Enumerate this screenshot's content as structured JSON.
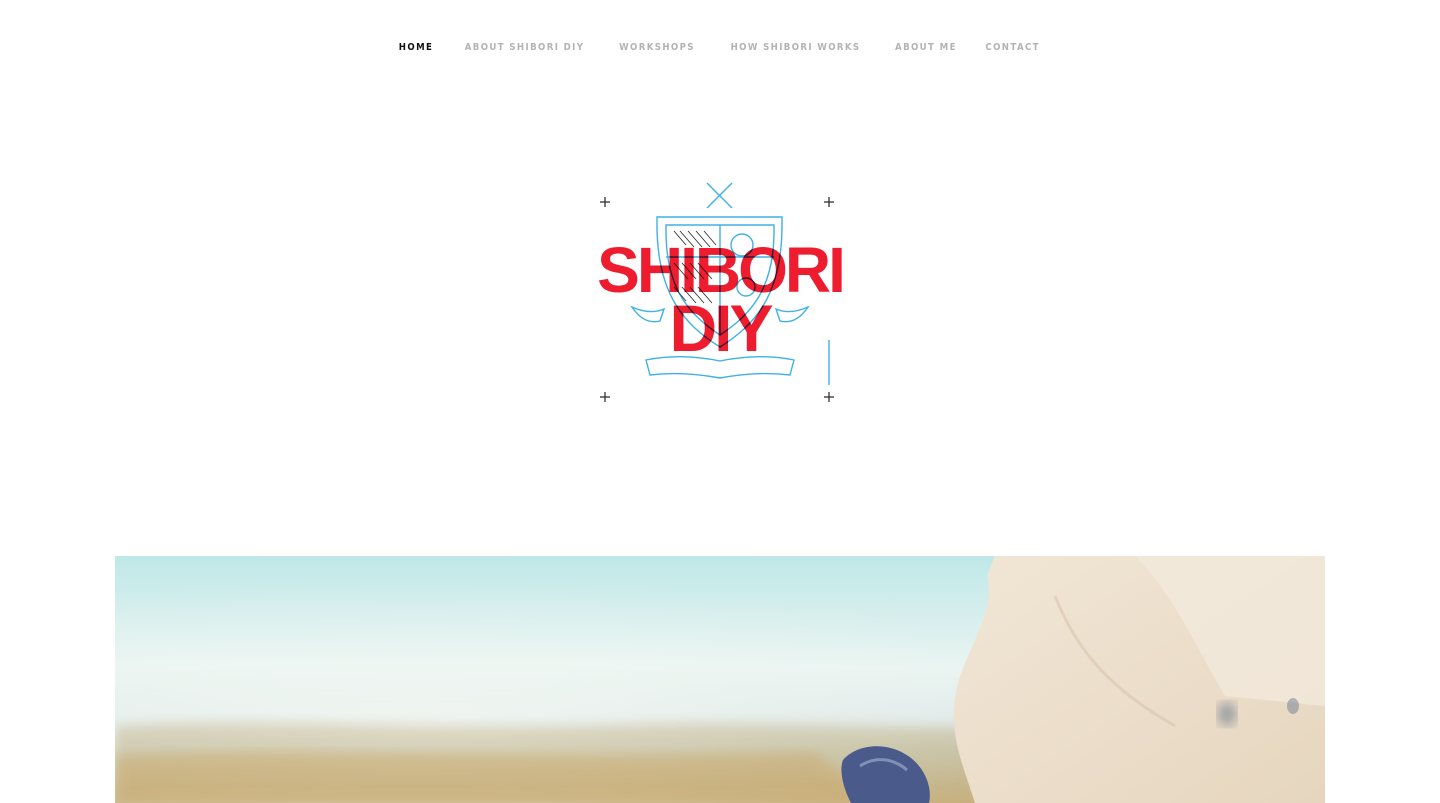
{
  "nav": {
    "items": [
      {
        "label": "HOME",
        "active": true
      },
      {
        "label": "ABOUT SHIBORI DIY",
        "active": false
      },
      {
        "label": "WORKSHOPS",
        "active": false
      },
      {
        "label": "HOW SHIBORI WORKS",
        "active": false
      },
      {
        "label": "ABOUT ME",
        "active": false
      },
      {
        "label": "CONTACT",
        "active": false
      }
    ]
  },
  "logo": {
    "line1": "SHIBORI",
    "line2": "DIY"
  },
  "colors": {
    "brand_red": "#ed1c2e",
    "crest_blue": "#3fb1e6",
    "nav_inactive": "#b3b3b3",
    "nav_active": "#111111"
  }
}
